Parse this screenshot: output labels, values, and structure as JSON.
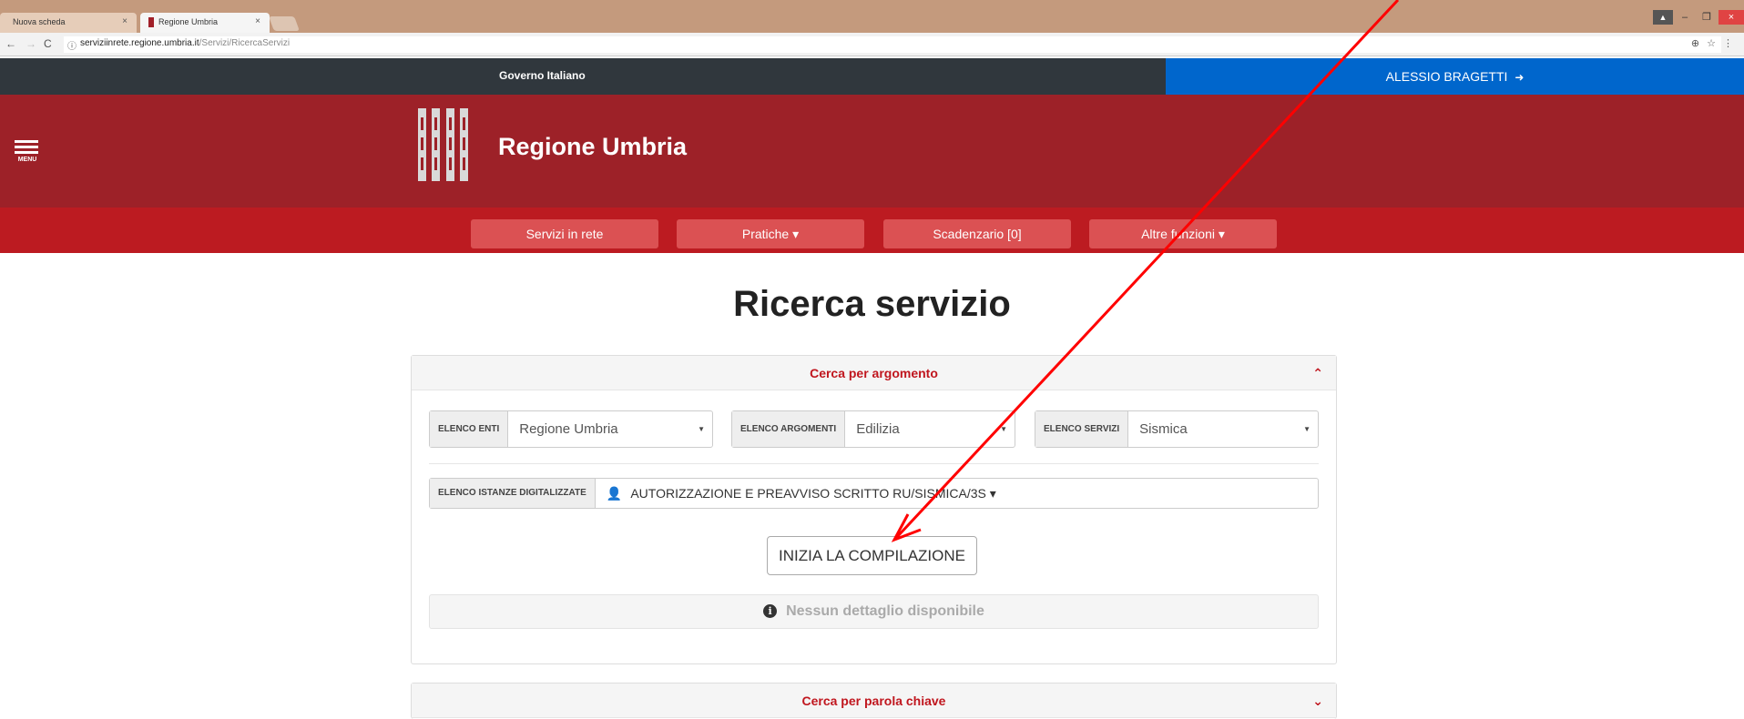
{
  "browser": {
    "tabs": [
      {
        "label": "Nuova scheda",
        "close": "×"
      },
      {
        "label": "Regione Umbria",
        "close": "×"
      }
    ],
    "url_host": "serviziinrete.regione.umbria.it",
    "url_path": "/Servizi/RicercaServizi",
    "nav": {
      "back": "←",
      "forward": "→",
      "reload": "C"
    },
    "addr_icons": "⊕☆⋮",
    "window_controls": {
      "user": "▲",
      "minimize": "–",
      "maximize": "❐",
      "close": "×"
    }
  },
  "gov_bar": {
    "label": "Governo Italiano"
  },
  "user_bar": {
    "name": "ALESSIO BRAGETTI",
    "logout_icon": "➜"
  },
  "header": {
    "menu_label": "MENU",
    "title": "Regione Umbria"
  },
  "nav": {
    "items": [
      {
        "label": "Servizi in rete"
      },
      {
        "label": "Pratiche ▾"
      },
      {
        "label": "Scadenzario [0]"
      },
      {
        "label": "Altre funzioni ▾"
      }
    ]
  },
  "page": {
    "title": "Ricerca servizio"
  },
  "panel_argomento": {
    "title": "Cerca per argomento",
    "toggle": "⌃",
    "enti": {
      "label": "ELENCO ENTI",
      "value": "Regione Umbria"
    },
    "argomenti": {
      "label": "ELENCO ARGOMENTI",
      "value": "Edilizia"
    },
    "servizi": {
      "label": "ELENCO SERVIZI",
      "value": "Sismica"
    },
    "istanze": {
      "label": "ELENCO ISTANZE DIGITALIZZATE",
      "value": "AUTORIZZAZIONE E PREAVVISO SCRITTO RU/SISMICA/3S ▾"
    },
    "start_button": "INIZIA LA COMPILAZIONE",
    "info_text": "Nessun dettaglio disponibile"
  },
  "panel_parola_chiave": {
    "title": "Cerca per parola chiave",
    "toggle": "⌄"
  },
  "colors": {
    "header": "#9d2128",
    "navbar": "#bc1b21",
    "nav_button": "#db5153",
    "user_bar": "#0066cc",
    "gov_bar": "#30373d",
    "accent_text": "#c0161e",
    "annotation_arrow": "#ff0000"
  }
}
